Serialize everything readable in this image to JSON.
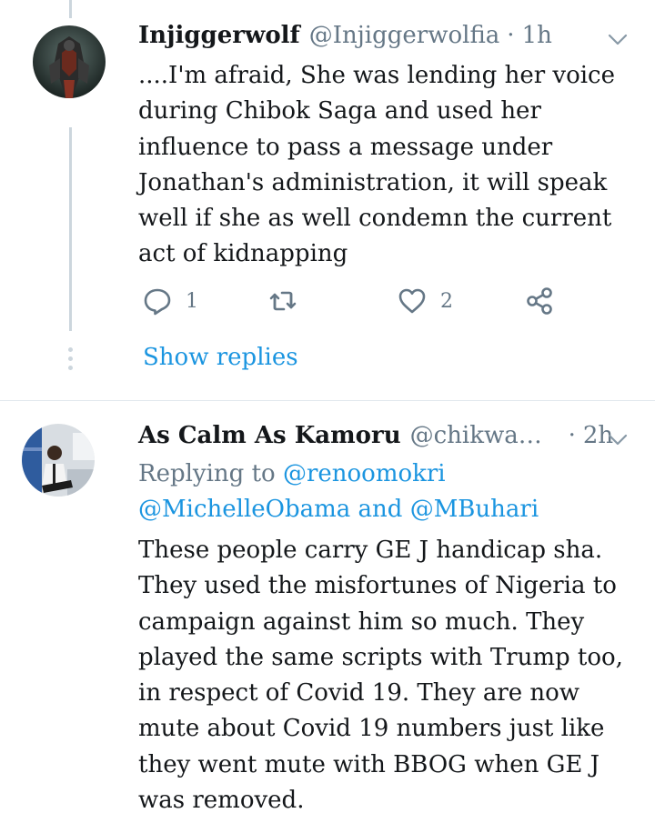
{
  "tweets": [
    {
      "name": "Injiggerwolf",
      "handle": "@Injiggerwolfia",
      "separator": "·",
      "time": "1h",
      "body": "....I'm afraid, She was lending her voice during Chibok Saga and used her influence to pass a message under Jonathan's administration, it will speak well if she as well condemn the current act of kidnapping",
      "reply_count": "1",
      "like_count": "2",
      "show_replies": "Show replies"
    },
    {
      "name": "As Calm As Kamoru",
      "handle": "@chikwad...",
      "separator": "·",
      "time": "2h",
      "replying_to_prefix": "Replying to",
      "reply_mention_1": "@renoomokri",
      "reply_mention_2": "@MichelleObama",
      "reply_and": "and",
      "reply_mention_3": "@MBuhari",
      "body": "These people carry GE J handicap sha. They used the misfortunes of Nigeria to campaign against him so much. They played the same scripts with Trump too, in respect of Covid 19. They are now mute about Covid 19 numbers just like they went mute with BBOG when GE J was removed."
    }
  ],
  "icons": {
    "reply": "reply-icon",
    "retweet": "retweet-icon",
    "like": "heart-icon",
    "share": "share-icon",
    "menu": "chevron-down-icon"
  },
  "colors": {
    "link": "#1b95e0",
    "muted": "#657786",
    "thread_line": "#ccd6dd"
  }
}
